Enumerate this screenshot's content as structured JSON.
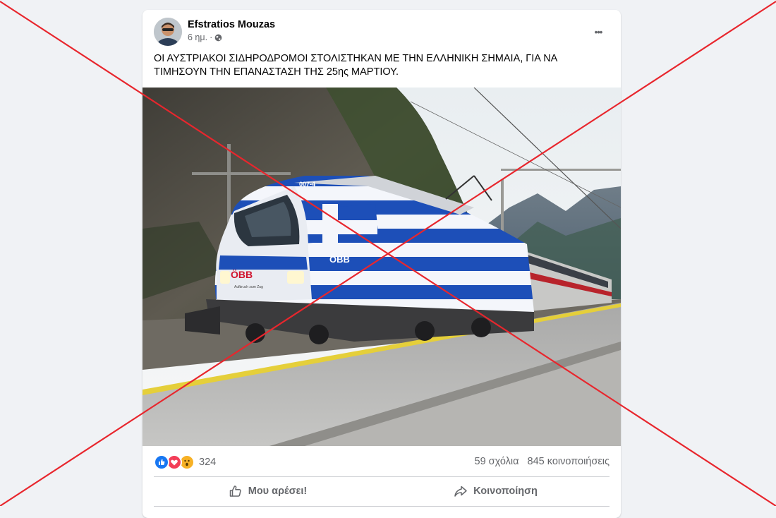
{
  "post": {
    "author": "Efstratios Mouzas",
    "time": "6 ημ.",
    "dot": "·",
    "privacy_icon": "globe-icon",
    "text": "ΟΙ ΑΥΣΤΡΙΑΚΟΙ ΣΙΔΗΡΟΔΡΟΜΟΙ ΣΤΟΛΙΣΤΗΚΑΝ ΜΕ ΤΗΝ ΕΛΛΗΝΙΚΗ ΣΗΜΑΙΑ, ΓΙΑ ΝΑ ΤΙΜΗΣΟΥΝ ΤΗΝ ΕΠΑΝΑΣΤΑΣΗ ΤΗΣ 25ης ΜΑΡΤΙΟΥ.",
    "more_label": "•••"
  },
  "image": {
    "locomotive_number": "007-4",
    "brand": "ÖBB",
    "slogan": "Aufbruch zum Zug"
  },
  "stats": {
    "reaction_icons": [
      "like-icon",
      "love-icon",
      "wow-icon"
    ],
    "reactions_count": "324",
    "comments": "59 σχόλια",
    "shares": "845 κοινοποιήσεις"
  },
  "actions": {
    "like_label": "Μου αρέσει!",
    "share_label": "Κοινοποίηση"
  },
  "colors": {
    "background": "#f0f2f5",
    "card": "#ffffff",
    "text_primary": "#050505",
    "text_secondary": "#65676b",
    "like_blue": "#1877f2",
    "love_red": "#f33e58",
    "wow_yellow": "#f7b125",
    "cross_red": "#e8262d",
    "greek_blue": "#1d4fb8"
  }
}
